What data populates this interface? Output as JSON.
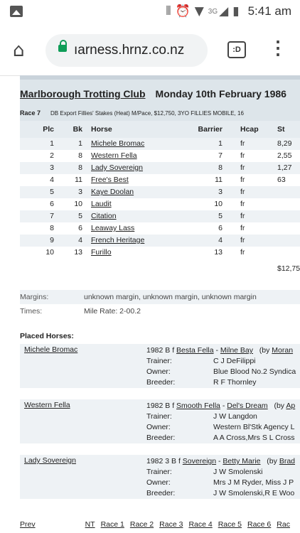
{
  "status_bar": {
    "time": "5:41 am",
    "network": "3G"
  },
  "browser": {
    "url": "ıarness.hrnz.co.nz",
    "tab_button": ":D"
  },
  "meeting": {
    "club": "Marlborough Trotting Club",
    "date": "Monday  10th  February  1986"
  },
  "race": {
    "number": "Race 7",
    "description": "DB Export Fillies' Stakes (Heat) M/Pace, $12,750, 3YO FILLIES MOBILE, 16"
  },
  "columns": {
    "plc": "Plc",
    "bk": "Bk",
    "horse": "Horse",
    "barrier": "Barrier",
    "hcap": "Hcap",
    "stake": "St"
  },
  "results": [
    {
      "plc": "1",
      "bk": "1",
      "horse": "Michele Bromac",
      "barrier": "1",
      "hcap": "fr",
      "stake": "8,29"
    },
    {
      "plc": "2",
      "bk": "8",
      "horse": "Western Fella",
      "barrier": "7",
      "hcap": "fr",
      "stake": "2,55"
    },
    {
      "plc": "3",
      "bk": "8",
      "horse": "Lady Sovereign",
      "barrier": "8",
      "hcap": "fr",
      "stake": "1,27"
    },
    {
      "plc": "4",
      "bk": "11",
      "horse": "Free's Best",
      "barrier": "11",
      "hcap": "fr",
      "stake": "63"
    },
    {
      "plc": "5",
      "bk": "3",
      "horse": "Kaye Doolan",
      "barrier": "3",
      "hcap": "fr",
      "stake": ""
    },
    {
      "plc": "6",
      "bk": "10",
      "horse": "Laudit",
      "barrier": "10",
      "hcap": "fr",
      "stake": ""
    },
    {
      "plc": "7",
      "bk": "5",
      "horse": "Citation",
      "barrier": "5",
      "hcap": "fr",
      "stake": ""
    },
    {
      "plc": "8",
      "bk": "6",
      "horse": "Leaway Lass",
      "barrier": "6",
      "hcap": "fr",
      "stake": ""
    },
    {
      "plc": "9",
      "bk": "4",
      "horse": "French Heritage",
      "barrier": "4",
      "hcap": "fr",
      "stake": ""
    },
    {
      "plc": "10",
      "bk": "13",
      "horse": "Furillo",
      "barrier": "13",
      "hcap": "fr",
      "stake": ""
    }
  ],
  "total_stake": "$12,75",
  "margins": {
    "label": "Margins:",
    "value": "unknown margin, unknown margin, unknown margin"
  },
  "times": {
    "label": "Times:",
    "value": "Mile Rate: 2-00.2"
  },
  "placed_heading": "Placed Horses:",
  "placed": [
    {
      "name": "Michele Bromac",
      "pedigree_prefix": "1982 B f ",
      "sire": "Besta Fella",
      "dam": "Milne Bay",
      "by_prefix": "(by ",
      "damsire": "Moran",
      "trainer_label": "Trainer:",
      "trainer": "C J DeFilippi",
      "owner_label": "Owner:",
      "owner": "Blue Blood No.2 Syndica",
      "breeder_label": "Breeder:",
      "breeder": "R F Thornley"
    },
    {
      "name": "Western Fella",
      "pedigree_prefix": "1982 B f ",
      "sire": "Smooth Fella",
      "dam": "Del's Dream",
      "by_prefix": "(by ",
      "damsire": "Ap",
      "trainer_label": "Trainer:",
      "trainer": "J W Langdon",
      "owner_label": "Owner:",
      "owner": "Western Bl'Stk Agency L",
      "breeder_label": "Breeder:",
      "breeder": "A A Cross,Mrs S L Cross"
    },
    {
      "name": "Lady Sovereign",
      "pedigree_prefix": "1982 3 B f ",
      "sire": "Sovereign",
      "dam": "Betty Marie",
      "by_prefix": "(by ",
      "damsire": "Brad",
      "trainer_label": "Trainer:",
      "trainer": "J W Smolenski",
      "owner_label": "Owner:",
      "owner": "Mrs J M Ryder, Miss J P",
      "breeder_label": "Breeder:",
      "breeder": "J W Smolenski,R E Woo"
    }
  ],
  "footer": {
    "prev": "Prev",
    "links": [
      "NT",
      "Race 1",
      "Race 2",
      "Race 3",
      "Race 4",
      "Race 5",
      "Race 6",
      "Rac"
    ]
  }
}
